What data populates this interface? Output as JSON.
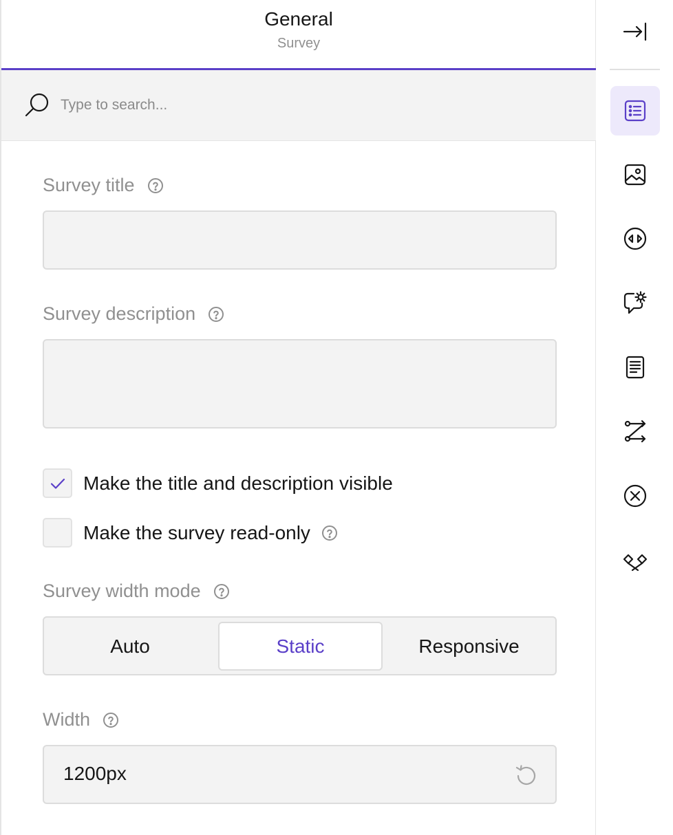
{
  "header": {
    "title": "General",
    "subtitle": "Survey"
  },
  "search": {
    "placeholder": "Type to search...",
    "value": ""
  },
  "form": {
    "survey_title": {
      "label": "Survey title",
      "value": ""
    },
    "survey_description": {
      "label": "Survey description",
      "value": ""
    },
    "show_title_checkbox": {
      "label": "Make the title and description visible",
      "checked": true
    },
    "read_only_checkbox": {
      "label": "Make the survey read-only",
      "checked": false
    },
    "width_mode": {
      "label": "Survey width mode",
      "options": [
        "Auto",
        "Static",
        "Responsive"
      ],
      "selected": "Static"
    },
    "width": {
      "label": "Width",
      "value": "1200px"
    }
  },
  "sidebar": {
    "items": [
      {
        "icon": "collapse-panel-icon"
      },
      {
        "icon": "general-settings-icon",
        "active": true
      },
      {
        "icon": "logo-image-icon"
      },
      {
        "icon": "navigation-icon"
      },
      {
        "icon": "question-settings-icon"
      },
      {
        "icon": "pages-icon"
      },
      {
        "icon": "logic-icon"
      },
      {
        "icon": "validation-icon"
      },
      {
        "icon": "timer-icon"
      }
    ]
  },
  "colors": {
    "accent": "#5a3fc8",
    "active_bg": "#ede9fb",
    "field_bg": "#f3f3f3",
    "label_gray": "#909090"
  }
}
